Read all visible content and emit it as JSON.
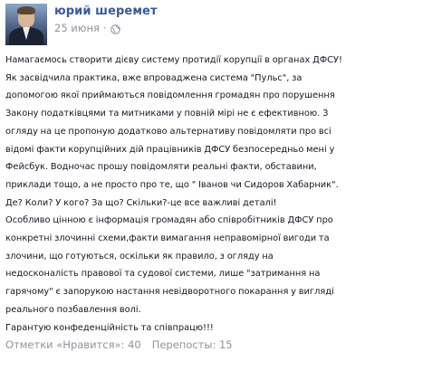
{
  "post": {
    "author": "юрий шеремет",
    "date": "25 июня",
    "separator": "·",
    "privacy_icon": "globe-icon",
    "lines": [
      "Намагаємось створити дієву систему протидії корупції в органах ДФСУ!",
      "Як засвідчила практика, вже впроваджена система \"Пульс\", за",
      "допомогою якої приймаються повідомлення громадян про порушення",
      "Закону податківцями та митниками у повній мірі не є ефективною. З",
      "огляду на це пропоную додатково альтернативу повідомляти про всі",
      "відомі факти корупційних дій працівників ДФСУ безпосередньо мені у",
      "Фейсбук. Водночас прошу повідомляти реальні факти, обставини,",
      "приклади тощо, а не просто про те, що \" Іванов чи Сидоров Хабарник\".",
      "Де? Коли? У кого? За що? Скільки?-це все важливі деталі!",
      "Особливо цінною є інформація громадян або співробітників ДФСУ про",
      "конкретні злочинні схеми,факти вимагання неправомірної вигоди та",
      "злочини, що готуються, оскільки як правило, з огляду на",
      "недосконалість правової та судової системи, лише \"затримання на",
      "гарячому\" є запорукою настання невідворотного покарання у вигляді",
      "реального позбавлення волі.",
      "Гарантую конфеденційність та співпрацю!!!"
    ]
  },
  "footer": {
    "likes": "Отметки «Нравится»: 40",
    "shares": "Перепосты: 15"
  }
}
